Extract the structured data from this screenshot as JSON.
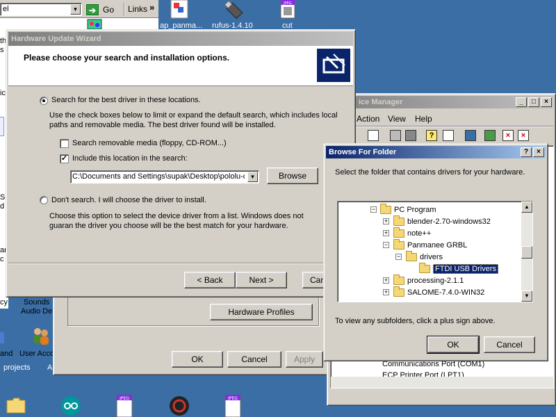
{
  "browser_bar": {
    "address_value": "el",
    "go_label": "Go",
    "links_label": "Links",
    "chevron": "»"
  },
  "desktop_icons": [
    {
      "label": "ap_panma...",
      "icon": "paint-icon"
    },
    {
      "label": "rufus-1.4.10",
      "icon": "usb-drive-icon"
    },
    {
      "label": "cut",
      "icon": "jpeg-file-icon"
    }
  ],
  "left_fragments": {
    "th": "th",
    "s": "s",
    "ic": "ic",
    "se": "Se",
    "d": "d",
    "ar": "ar",
    "c": "c",
    "cy": "cy",
    "sounds": "Sounds",
    "audio_de": "Audio De",
    "and": "and",
    "user_acc": "User Acco",
    "projects": "projects",
    "a": "A"
  },
  "wizard": {
    "title": "Hardware Update Wizard",
    "header": "Please choose your search and installation options.",
    "option_search": "Search for the best driver in these locations.",
    "option_search_desc": "Use the check boxes below to limit or expand the default search, which includes local paths and removable media. The best driver found will be installed.",
    "check_removable": "Search removable media (floppy, CD-ROM...)",
    "check_include": "Include this location in the search:",
    "path_value": "C:\\Documents and Settings\\supak\\Desktop\\pololu-c",
    "browse_label": "Browse",
    "option_dont": "Don't search. I will choose the driver to install.",
    "option_dont_desc": "Choose this option to select the device driver from a list.  Windows does not guaran the driver you choose will be the best match for your hardware.",
    "back_label": "< Back",
    "next_label": "Next >",
    "cancel_label": "Can"
  },
  "sysprops": {
    "hardware_profiles_label": "Hardware Profiles",
    "ok_label": "OK",
    "cancel_label": "Cancel",
    "apply_label": "Apply"
  },
  "device_manager": {
    "title": "ice Manager",
    "menu": [
      "Action",
      "View",
      "Help"
    ],
    "items": [
      "Communications Port (COM1)",
      "ECP Printer Port (LPT1)"
    ]
  },
  "browse_folder": {
    "title": "Browse For Folder",
    "help_btn": "?",
    "close_btn": "×",
    "prompt": "Select the folder that contains drivers for your hardware.",
    "tree": [
      {
        "label": "PC Program",
        "expander": "−",
        "indent": 0
      },
      {
        "label": "blender-2.70-windows32",
        "expander": "+",
        "indent": 1
      },
      {
        "label": "note++",
        "expander": "+",
        "indent": 1
      },
      {
        "label": "Panmanee GRBL",
        "expander": "−",
        "indent": 1
      },
      {
        "label": "drivers",
        "expander": "−",
        "indent": 2
      },
      {
        "label": "FTDI USB Drivers",
        "expander": "",
        "indent": 3,
        "selected": true
      },
      {
        "label": "processing-2.1.1",
        "expander": "+",
        "indent": 1
      },
      {
        "label": "SALOME-7.4.0-WIN32",
        "expander": "+",
        "indent": 1
      }
    ],
    "hint": "To view any subfolders, click a plus sign above.",
    "ok_label": "OK",
    "cancel_label": "Cancel"
  },
  "taskbar_icons": [
    "folder-icon",
    "arduino-icon",
    "jpeg-file-icon",
    "app-icon",
    "jpeg-file-icon"
  ],
  "colors": {
    "desktop": "#3a6ea5",
    "face": "#d4d0c8",
    "title_active": "#0a246a",
    "selection": "#0a246a"
  }
}
